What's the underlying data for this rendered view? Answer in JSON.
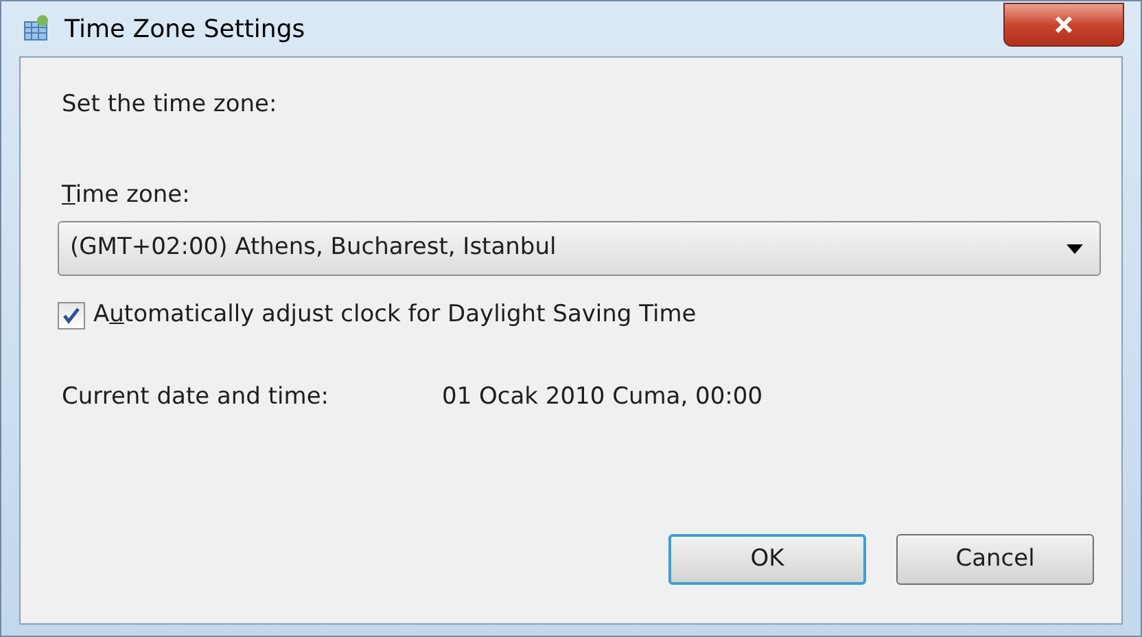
{
  "window": {
    "title": "Time Zone Settings"
  },
  "prompt": "Set the time zone:",
  "time_zone": {
    "label": {
      "access_key": "T",
      "rest": "ime zone:"
    },
    "value": "(GMT+02:00) Athens, Bucharest, Istanbul"
  },
  "dst_checkbox": {
    "label": {
      "before": "A",
      "access_key": "u",
      "rest": "tomatically adjust clock for Daylight Saving Time"
    },
    "checked": true
  },
  "current": {
    "label": "Current date and time:",
    "value": "01 Ocak 2010 Cuma, 00:00"
  },
  "buttons": [
    {
      "label": "OK",
      "default": true
    },
    {
      "label": "Cancel",
      "default": false
    }
  ]
}
